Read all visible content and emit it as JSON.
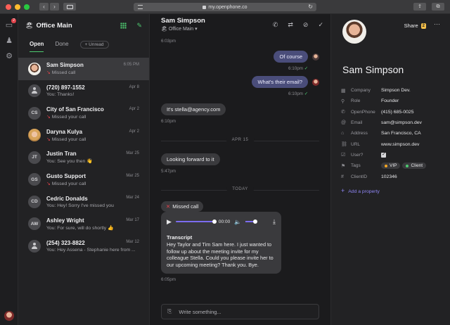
{
  "browser": {
    "url": "my.openphone.co",
    "nav_back": "‹",
    "nav_forward": "›",
    "share_icon": "⇪",
    "tabs_icon": "⧉",
    "reload_icon": "↻",
    "colors": {
      "close": "#ff5f57",
      "minimize": "#febc2e",
      "zoom": "#28c840"
    }
  },
  "rail": {
    "notification_count": "2",
    "inbox_icon": "▭",
    "contacts_icon": "♟",
    "settings_icon": "⚙"
  },
  "inbox": {
    "emoji": "🏖",
    "name": "Office Main",
    "tabs": {
      "open": "Open",
      "done": "Done",
      "unread": "+ Unread"
    },
    "conversations": [
      {
        "initials": "",
        "avatar": "photo1",
        "name": "Sam Simpson",
        "preview": "Missed call",
        "missed": true,
        "time": "6:05 PM"
      },
      {
        "initials": "",
        "avatar": "person",
        "name": "(720) 897-1552",
        "preview": "You: Thanks!",
        "missed": false,
        "time": "Apr 8"
      },
      {
        "initials": "CS",
        "avatar": "initials",
        "name": "City of San Francisco",
        "preview": "Missed your call",
        "missed": true,
        "time": "Apr 2"
      },
      {
        "initials": "",
        "avatar": "photo2",
        "name": "Daryna Kulya",
        "preview": "Missed your call",
        "missed": true,
        "time": "Apr 2"
      },
      {
        "initials": "JT",
        "avatar": "initials",
        "name": "Justin Tran",
        "preview": "You: See you then 👋",
        "missed": false,
        "time": "Mar 25"
      },
      {
        "initials": "GS",
        "avatar": "initials",
        "name": "Gusto Support",
        "preview": "Missed your call",
        "missed": true,
        "time": "Mar 25"
      },
      {
        "initials": "CD",
        "avatar": "initials",
        "name": "Cedric Donalds",
        "preview": "You: Hey! Sorry I've missed you",
        "missed": false,
        "time": "Mar 24"
      },
      {
        "initials": "AW",
        "avatar": "initials",
        "name": "Ashley Wright",
        "preview": "You: For sure, will do shortly 👍",
        "missed": false,
        "time": "Mar 17"
      },
      {
        "initials": "",
        "avatar": "person",
        "name": "(254) 323-8822",
        "preview": "You: Hey Assena - Stephanie here from ...",
        "missed": false,
        "time": "Mar 12"
      }
    ],
    "missed_icon": "↘"
  },
  "chat": {
    "title": "Sam Simpson",
    "subtitle_emoji": "🏖",
    "subtitle": "Office Main",
    "subtitle_caret": "▾",
    "actions": {
      "call": "✆",
      "transfer": "⇄",
      "block": "⊘",
      "done": "✓"
    },
    "messages": {
      "t0": "6:03pm",
      "m1": "Of course",
      "t1": "6:10pm",
      "m2": "What's their email?",
      "t2": "6:10pm",
      "m3": "It's stella@agency.com",
      "t3": "6:10pm",
      "divider1": "APR 15",
      "m4": "Looking forward to it",
      "t4": "5:47pm",
      "divider2": "TODAY",
      "missed_call": "Missed call",
      "voice_duration": "00:00",
      "transcript_title": "Transcript",
      "transcript_text": "Hey Taylor and Tim Sam here. I just wanted to follow up about the meeting invite for my colleague Stella. Could you please invite her to our upcoming meeting? Thank you. Bye.",
      "t5": "6:05pm"
    },
    "check": "✓",
    "composer_placeholder": "Write something...",
    "clip_icon": "⎘",
    "play_icon": "▶",
    "volume_icon": "🔈",
    "download_icon": "⤓"
  },
  "contact": {
    "name": "Sam Simpson",
    "share_label": "Share",
    "share_count": "2",
    "more_icon": "···",
    "properties": [
      {
        "icon": "▦",
        "key": "Company",
        "value": "Simpson Dev."
      },
      {
        "icon": "⚲",
        "key": "Role",
        "value": "Founder"
      },
      {
        "icon": "✆",
        "key": "OpenPhone",
        "value": "(415) 685-0025"
      },
      {
        "icon": "@",
        "key": "Email",
        "value": "sam@simpson.dev"
      },
      {
        "icon": "⌂",
        "key": "Address",
        "value": "San Francisco, CA"
      },
      {
        "icon": "⛓",
        "key": "URL",
        "value": "www.simpson.dev"
      },
      {
        "icon": "☑",
        "key": "User?",
        "value": ""
      },
      {
        "icon": "⚑",
        "key": "Tags",
        "value": ""
      },
      {
        "icon": "#",
        "key": "ClientID",
        "value": "102346"
      }
    ],
    "tags": [
      {
        "label": "VIP",
        "color": "#f5a623"
      },
      {
        "label": "Client",
        "color": "#4ecb71"
      }
    ],
    "user_checked": true,
    "add_property": "Add a property",
    "add_icon": "+"
  }
}
